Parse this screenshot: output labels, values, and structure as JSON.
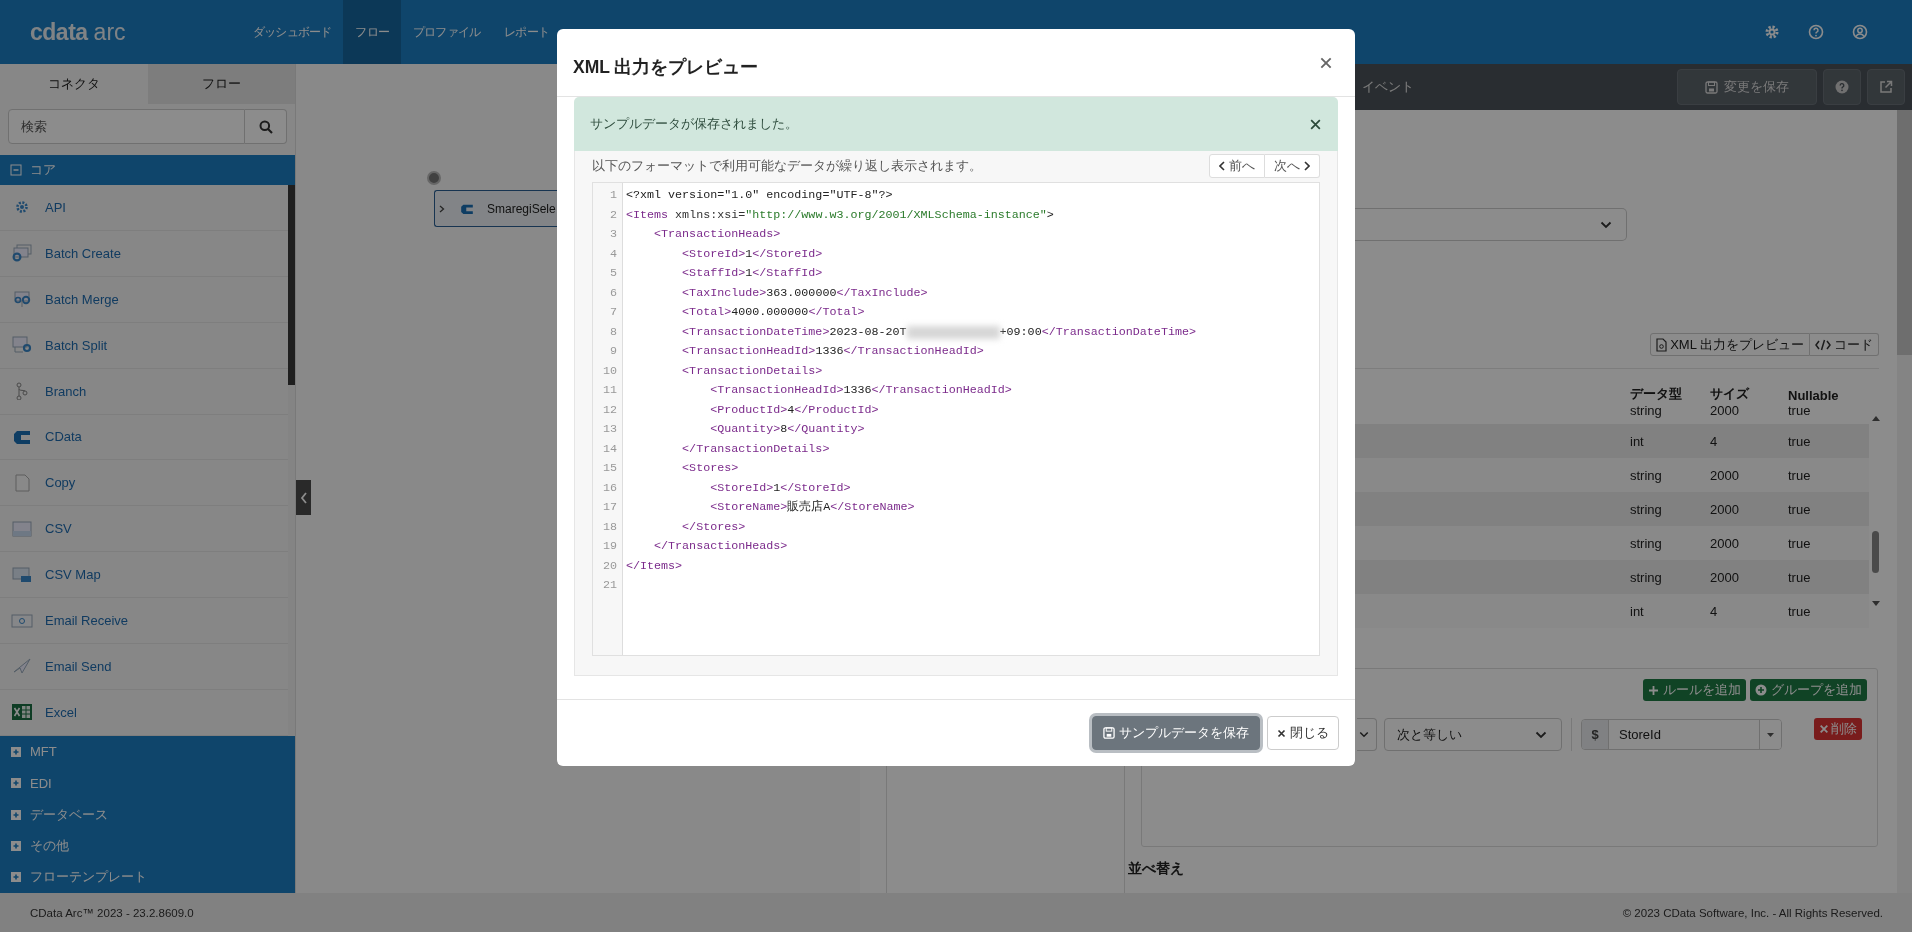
{
  "top_bar": {
    "logo": {
      "brand": "cdata",
      "product": "arc"
    },
    "nav": [
      {
        "label": "ダッシュボード",
        "selected": false
      },
      {
        "label": "フロー",
        "selected": true
      },
      {
        "label": "プロファイル",
        "selected": false
      },
      {
        "label": "レポート",
        "selected": false
      }
    ]
  },
  "sidebar": {
    "tabs": [
      {
        "label": "コネクタ",
        "selected": true
      },
      {
        "label": "フロー",
        "selected": false
      }
    ],
    "search": {
      "placeholder": "検索"
    },
    "groups": [
      {
        "label": "コア",
        "expanded": true,
        "items": [
          "API",
          "Batch Create",
          "Batch Merge",
          "Batch Split",
          "Branch",
          "CData",
          "Copy",
          "CSV",
          "CSV Map",
          "Email Receive",
          "Email Send",
          "Excel"
        ]
      },
      {
        "label": "MFT",
        "expanded": false
      },
      {
        "label": "EDI",
        "expanded": false
      },
      {
        "label": "データベース",
        "expanded": false
      },
      {
        "label": "その他",
        "expanded": false
      },
      {
        "label": "フローテンプレート",
        "expanded": false
      }
    ]
  },
  "canvas": {
    "node": {
      "label": "SmaregiSele"
    }
  },
  "panel": {
    "tabs": [
      {
        "label": "イベント",
        "selected": false
      }
    ],
    "save_button": "変更を保存",
    "preview_button": "XML 出力をプレビュー",
    "code_button": "コード",
    "table": {
      "columns": [
        "データ型",
        "サイズ",
        "Nullable"
      ],
      "rows": [
        [
          "string",
          "2000",
          "true"
        ],
        [
          "int",
          "4",
          "true"
        ],
        [
          "string",
          "2000",
          "true"
        ],
        [
          "string",
          "2000",
          "true"
        ],
        [
          "string",
          "2000",
          "true"
        ],
        [
          "string",
          "2000",
          "true"
        ],
        [
          "int",
          "4",
          "true"
        ]
      ]
    },
    "filter": {
      "add_rule": "ルールを追加",
      "add_group": "グループを追加",
      "operator": "次と等しい",
      "value_prefix": "$",
      "value": "StoreId",
      "delete_button": "削除"
    },
    "sort_heading": "並べ替え"
  },
  "footer": {
    "version": "CData Arc™ 2023 - 23.2.8609.0",
    "copyright": "© 2023 CData Software, Inc. - All Rights Reserved."
  },
  "modal": {
    "title": "XML 出力をプレビュー",
    "alert": "サンプルデータが保存されました。",
    "description": "以下のフォーマットで利用可能なデータが繰り返し表示されます。",
    "prev_button": "前へ",
    "next_button": "次へ",
    "code_lines": [
      {
        "number": "1",
        "tokens": [
          {
            "kind": "text",
            "text": "<?xml version=\"1.0\" encoding=\"UTF-8\"?>"
          }
        ]
      },
      {
        "number": "2",
        "tokens": [
          {
            "kind": "tag",
            "text": "<Items"
          },
          {
            "kind": "attr",
            "text": " xmlns:xsi="
          },
          {
            "kind": "string",
            "text": "\"http://www.w3.org/2001/XMLSchema-instance\""
          },
          {
            "kind": "text",
            "text": ">"
          }
        ]
      },
      {
        "number": "3",
        "tokens": [
          {
            "kind": "tag",
            "text": "    <TransactionHeads>"
          }
        ]
      },
      {
        "number": "4",
        "tokens": [
          {
            "kind": "tag",
            "text": "        <StoreId>"
          },
          {
            "kind": "text",
            "text": "1"
          },
          {
            "kind": "tag",
            "text": "</StoreId>"
          }
        ]
      },
      {
        "number": "5",
        "tokens": [
          {
            "kind": "tag",
            "text": "        <StaffId>"
          },
          {
            "kind": "text",
            "text": "1"
          },
          {
            "kind": "tag",
            "text": "</StaffId>"
          }
        ]
      },
      {
        "number": "6",
        "tokens": [
          {
            "kind": "tag",
            "text": "        <TaxInclude>"
          },
          {
            "kind": "text",
            "text": "363.000000"
          },
          {
            "kind": "tag",
            "text": "</TaxInclude>"
          }
        ]
      },
      {
        "number": "7",
        "tokens": [
          {
            "kind": "tag",
            "text": "        <Total>"
          },
          {
            "kind": "text",
            "text": "4000.000000"
          },
          {
            "kind": "tag",
            "text": "</Total>"
          }
        ]
      },
      {
        "number": "8",
        "tokens": [
          {
            "kind": "tag",
            "text": "        <TransactionDateTime>"
          },
          {
            "kind": "text",
            "text": "2023-08-20T"
          },
          {
            "kind": "redacted"
          },
          {
            "kind": "text",
            "text": "+09:00"
          },
          {
            "kind": "tag",
            "text": "</TransactionDateTime>"
          }
        ]
      },
      {
        "number": "9",
        "tokens": [
          {
            "kind": "tag",
            "text": "        <TransactionHeadId>"
          },
          {
            "kind": "text",
            "text": "1336"
          },
          {
            "kind": "tag",
            "text": "</TransactionHeadId>"
          }
        ]
      },
      {
        "number": "10",
        "tokens": [
          {
            "kind": "tag",
            "text": "        <TransactionDetails>"
          }
        ]
      },
      {
        "number": "11",
        "tokens": [
          {
            "kind": "tag",
            "text": "            <TransactionHeadId>"
          },
          {
            "kind": "text",
            "text": "1336"
          },
          {
            "kind": "tag",
            "text": "</TransactionHeadId>"
          }
        ]
      },
      {
        "number": "12",
        "tokens": [
          {
            "kind": "tag",
            "text": "            <ProductId>"
          },
          {
            "kind": "text",
            "text": "4"
          },
          {
            "kind": "tag",
            "text": "</ProductId>"
          }
        ]
      },
      {
        "number": "13",
        "tokens": [
          {
            "kind": "tag",
            "text": "            <Quantity>"
          },
          {
            "kind": "text",
            "text": "8"
          },
          {
            "kind": "tag",
            "text": "</Quantity>"
          }
        ]
      },
      {
        "number": "14",
        "tokens": [
          {
            "kind": "tag",
            "text": "        </TransactionDetails>"
          }
        ]
      },
      {
        "number": "15",
        "tokens": [
          {
            "kind": "tag",
            "text": "        <Stores>"
          }
        ]
      },
      {
        "number": "16",
        "tokens": [
          {
            "kind": "tag",
            "text": "            <StoreId>"
          },
          {
            "kind": "text",
            "text": "1"
          },
          {
            "kind": "tag",
            "text": "</StoreId>"
          }
        ]
      },
      {
        "number": "17",
        "tokens": [
          {
            "kind": "tag",
            "text": "            <StoreName>"
          },
          {
            "kind": "text",
            "text": "販売店A"
          },
          {
            "kind": "tag",
            "text": "</StoreName>"
          }
        ]
      },
      {
        "number": "18",
        "tokens": [
          {
            "kind": "tag",
            "text": "        </Stores>"
          }
        ]
      },
      {
        "number": "19",
        "tokens": [
          {
            "kind": "tag",
            "text": "    </TransactionHeads>"
          }
        ]
      },
      {
        "number": "20",
        "tokens": [
          {
            "kind": "tag",
            "text": "</Items>"
          }
        ]
      },
      {
        "number": "21"
      }
    ],
    "save_button": "サンプルデータを保存",
    "close_button": "閉じる"
  }
}
